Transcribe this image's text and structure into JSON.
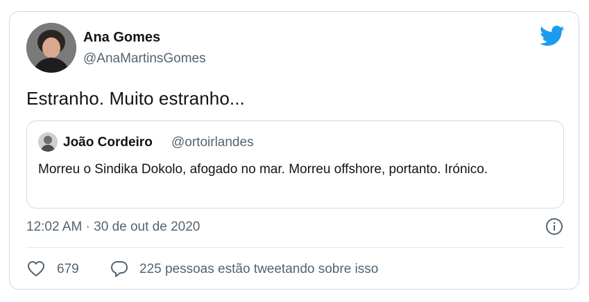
{
  "tweet": {
    "author_name": "Ana Gomes",
    "author_handle": "@AnaMartinsGomes",
    "text": "Estranho. Muito estranho...",
    "timestamp": "12:02 AM · 30 de out de 2020",
    "likes": "679",
    "conversation": "225 pessoas estão tweetando sobre isso"
  },
  "quoted": {
    "author_name": "João Cordeiro",
    "author_handle": "@ortoirlandes",
    "text": "Morreu o Sindika Dokolo, afogado no mar. Morreu offshore, portanto. Irónico."
  },
  "colors": {
    "twitter_blue": "#1d9bf0",
    "secondary_text": "#536471",
    "border": "#cfd9de"
  },
  "icons": [
    "twitter-bird-icon",
    "info-icon",
    "heart-icon",
    "reply-bubble-icon"
  ]
}
